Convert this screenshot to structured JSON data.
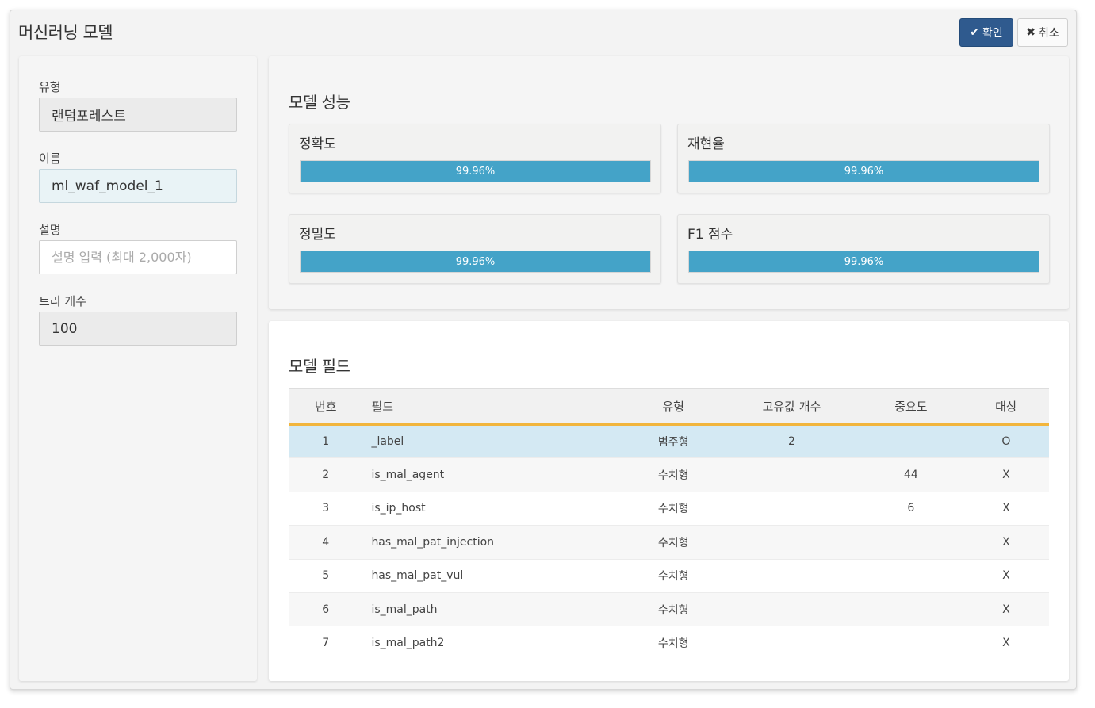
{
  "dialog": {
    "title": "머신러닝 모델",
    "confirm_label": "확인",
    "cancel_label": "취소"
  },
  "form": {
    "type_label": "유형",
    "type_value": "랜덤포레스트",
    "name_label": "이름",
    "name_value": "ml_waf_model_1",
    "desc_label": "설명",
    "desc_placeholder": "설명 입력 (최대 2,000자)",
    "trees_label": "트리 개수",
    "trees_value": "100"
  },
  "performance": {
    "title": "모델 성능",
    "metrics": [
      {
        "label": "정확도",
        "value": "99.96%",
        "fraction": 0.9996
      },
      {
        "label": "재현율",
        "value": "99.96%",
        "fraction": 0.9996
      },
      {
        "label": "정밀도",
        "value": "99.96%",
        "fraction": 0.9996
      },
      {
        "label": "F1 점수",
        "value": "99.96%",
        "fraction": 0.9996
      }
    ]
  },
  "fields": {
    "title": "모델 필드",
    "columns": [
      "번호",
      "필드",
      "유형",
      "고유값 개수",
      "중요도",
      "대상"
    ],
    "rows": [
      {
        "num": "1",
        "field": "_label",
        "type": "범주형",
        "unique": "2",
        "importance": "",
        "target": "O",
        "selected": true
      },
      {
        "num": "2",
        "field": "is_mal_agent",
        "type": "수치형",
        "unique": "",
        "importance": "44",
        "target": "X"
      },
      {
        "num": "3",
        "field": "is_ip_host",
        "type": "수치형",
        "unique": "",
        "importance": "6",
        "target": "X"
      },
      {
        "num": "4",
        "field": "has_mal_pat_injection",
        "type": "수치형",
        "unique": "",
        "importance": "",
        "target": "X"
      },
      {
        "num": "5",
        "field": "has_mal_pat_vul",
        "type": "수치형",
        "unique": "",
        "importance": "",
        "target": "X"
      },
      {
        "num": "6",
        "field": "is_mal_path",
        "type": "수치형",
        "unique": "",
        "importance": "",
        "target": "X"
      },
      {
        "num": "7",
        "field": "is_mal_path2",
        "type": "수치형",
        "unique": "",
        "importance": "",
        "target": "X"
      }
    ]
  },
  "icons": {
    "confirm": "check-icon",
    "cancel": "times-icon"
  },
  "colors": {
    "primary": "#2f5a8e",
    "progress": "#44a3c8",
    "header_accent": "#f2b53c",
    "selected_row": "#d4e9f3"
  }
}
